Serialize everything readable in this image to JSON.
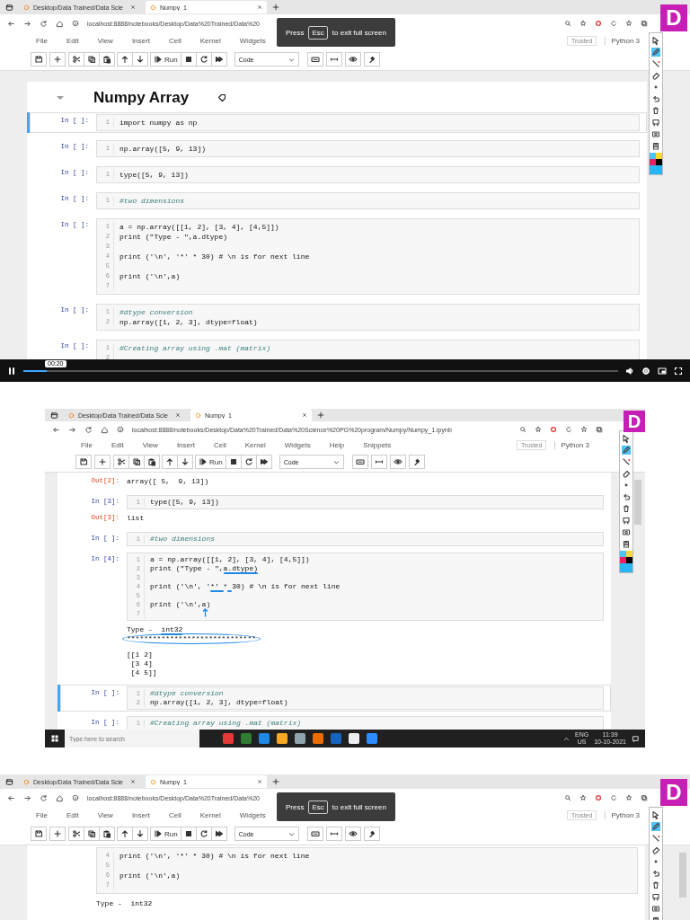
{
  "frames": [
    {
      "browser_tabs": [
        {
          "title": "Desktop/Data Trained/Data Scie",
          "selected": false
        },
        {
          "title": "Numpy_1",
          "selected": true
        }
      ],
      "url": "localhost:8888/notebooks/Desktop/Data%20Trained/Data%20",
      "fullscreen_notice": {
        "before": "Press",
        "key": "Esc",
        "after": "to exit full screen"
      },
      "menu": [
        "File",
        "Edit",
        "View",
        "Insert",
        "Cell",
        "Kernel",
        "Widgets"
      ],
      "kernel_status": [
        "Trusted",
        "Python 3"
      ],
      "run_label": "Run",
      "cell_type": "Code",
      "logo": "D",
      "cells": [
        {
          "kind": "heading",
          "text": "Numpy Array"
        },
        {
          "kind": "code",
          "prompt": "In [ ]:",
          "selected": true,
          "lines": [
            {
              "n": "1",
              "code": "import numpy as np"
            }
          ]
        },
        {
          "kind": "code",
          "prompt": "In [ ]:",
          "selected": false,
          "lines": [
            {
              "n": "1",
              "code": "np.array([5, 9, 13])"
            }
          ]
        },
        {
          "kind": "code",
          "prompt": "In [ ]:",
          "selected": false,
          "lines": [
            {
              "n": "1",
              "code": "type([5, 9, 13])"
            }
          ]
        },
        {
          "kind": "code",
          "prompt": "In [ ]:",
          "selected": false,
          "lines": [
            {
              "n": "1",
              "code": "#two dimensions",
              "comment": true
            }
          ]
        },
        {
          "kind": "code",
          "prompt": "In [ ]:",
          "selected": false,
          "lines": [
            {
              "n": "1",
              "code": "a = np.array([[1, 2], [3, 4], [4,5]])"
            },
            {
              "n": "2",
              "code": "print (\"Type - \",a.dtype)"
            },
            {
              "n": "3"
            },
            {
              "n": "4",
              "code": "print ('\\n', '*' * 30) # \\n is for next line"
            },
            {
              "n": "5"
            },
            {
              "n": "6",
              "code": "print ('\\n',a)"
            },
            {
              "n": "7"
            }
          ]
        },
        {
          "kind": "code",
          "prompt": "In [ ]:",
          "selected": false,
          "lines": [
            {
              "n": "1",
              "code": "#dtype conversion",
              "comment": true
            },
            {
              "n": "2",
              "code": "np.array([1, 2, 3], dtype=float)"
            }
          ]
        },
        {
          "kind": "code",
          "prompt": "In [ ]:",
          "selected": false,
          "lines": [
            {
              "n": "1",
              "code": "#Creating array using .mat (matrix)",
              "comment": true
            },
            {
              "n": "2"
            }
          ]
        }
      ],
      "player": {
        "time": "00:20",
        "level": 0.04
      }
    },
    {
      "browser_tabs": [
        {
          "title": "Desktop/Data Trained/Data Scie",
          "selected": false
        },
        {
          "title": "Numpy_1",
          "selected": true
        }
      ],
      "url": "localhost:8888/notebooks/Desktop/Data%20Trained/Data%20Science%20PG%20program/Numpy/Numpy_1.ipynb",
      "menu": [
        "File",
        "Edit",
        "View",
        "Insert",
        "Cell",
        "Kernel",
        "Widgets",
        "Help",
        "Snippets"
      ],
      "kernel_status": [
        "Trusted",
        "Python 3"
      ],
      "run_label": "Run",
      "cell_type": "Code",
      "logo": "D",
      "cells": [
        {
          "kind": "output",
          "prompt": "Out[2]:",
          "lines": [
            "array([ 5,  9, 13])"
          ]
        },
        {
          "kind": "code",
          "prompt": "In [3]:",
          "selected": false,
          "lines": [
            {
              "n": "1",
              "code": "type([5, 9, 13])"
            }
          ],
          "outputs": [
            {
              "prompt": "Out[3]:",
              "lines": [
                "list"
              ]
            }
          ]
        },
        {
          "kind": "code",
          "prompt": "In [ ]:",
          "selected": false,
          "lines": [
            {
              "n": "1",
              "code": "#two dimensions",
              "comment": true
            }
          ]
        },
        {
          "kind": "code",
          "prompt": "In [4]:",
          "selected": false,
          "pen_marks": true,
          "lines": [
            {
              "n": "1",
              "code": "a = np.array([[1, 2], [3, 4], [4,5]])"
            },
            {
              "n": "2",
              "code": "print (\"Type - \",a.dtype)"
            },
            {
              "n": "3"
            },
            {
              "n": "4",
              "code": "print ('\\n', '*' * 30) # \\n is for next line"
            },
            {
              "n": "5"
            },
            {
              "n": "6",
              "code": "print ('\\n',a)"
            },
            {
              "n": "7"
            }
          ],
          "outputs": [
            {
              "lines": [
                "Type -  int32",
                "******************************"
              ]
            },
            {
              "lines": [
                "[[1 2]",
                " [3 4]",
                " [4 5]]"
              ]
            }
          ]
        },
        {
          "kind": "code",
          "prompt": "In [ ]:",
          "selected": true,
          "lines": [
            {
              "n": "1",
              "code": "#dtype conversion",
              "comment": true
            },
            {
              "n": "2",
              "code": "np.array([1, 2, 3], dtype=float)"
            }
          ]
        },
        {
          "kind": "code",
          "prompt": "In [ ]:",
          "selected": false,
          "lines": [
            {
              "n": "1",
              "code": "#Creating array using .mat (matrix)",
              "comment": true
            }
          ]
        }
      ],
      "taskbar": {
        "search_placeholder": "Type here to search",
        "language": [
          "ENG",
          "US"
        ],
        "time": "11:39",
        "date": "10-10-2021"
      }
    },
    {
      "browser_tabs": [
        {
          "title": "Desktop/Data Trained/Data Scie",
          "selected": false
        },
        {
          "title": "Numpy_1",
          "selected": true
        }
      ],
      "url": "localhost:8888/notebooks/Desktop/Data%20Trained/Data%20",
      "fullscreen_notice": {
        "before": "Press",
        "key": "Esc",
        "after": "to exit full screen"
      },
      "menu": [
        "File",
        "Edit",
        "View",
        "Insert",
        "Cell",
        "Kernel",
        "Widgets"
      ],
      "kernel_status": [
        "Trusted",
        "Python 3"
      ],
      "run_label": "Run",
      "cell_type": "Code",
      "logo": "D",
      "cells": [
        {
          "kind": "code",
          "selected": false,
          "lines": [
            {
              "n": "4",
              "code": "print ('\\n', '*' * 30) # \\n is for next line"
            },
            {
              "n": "5"
            },
            {
              "n": "6",
              "code": "print ('\\n',a)"
            },
            {
              "n": "7"
            }
          ],
          "outputs": [
            {
              "lines": [
                "Type -  int32"
              ]
            }
          ]
        }
      ]
    }
  ]
}
